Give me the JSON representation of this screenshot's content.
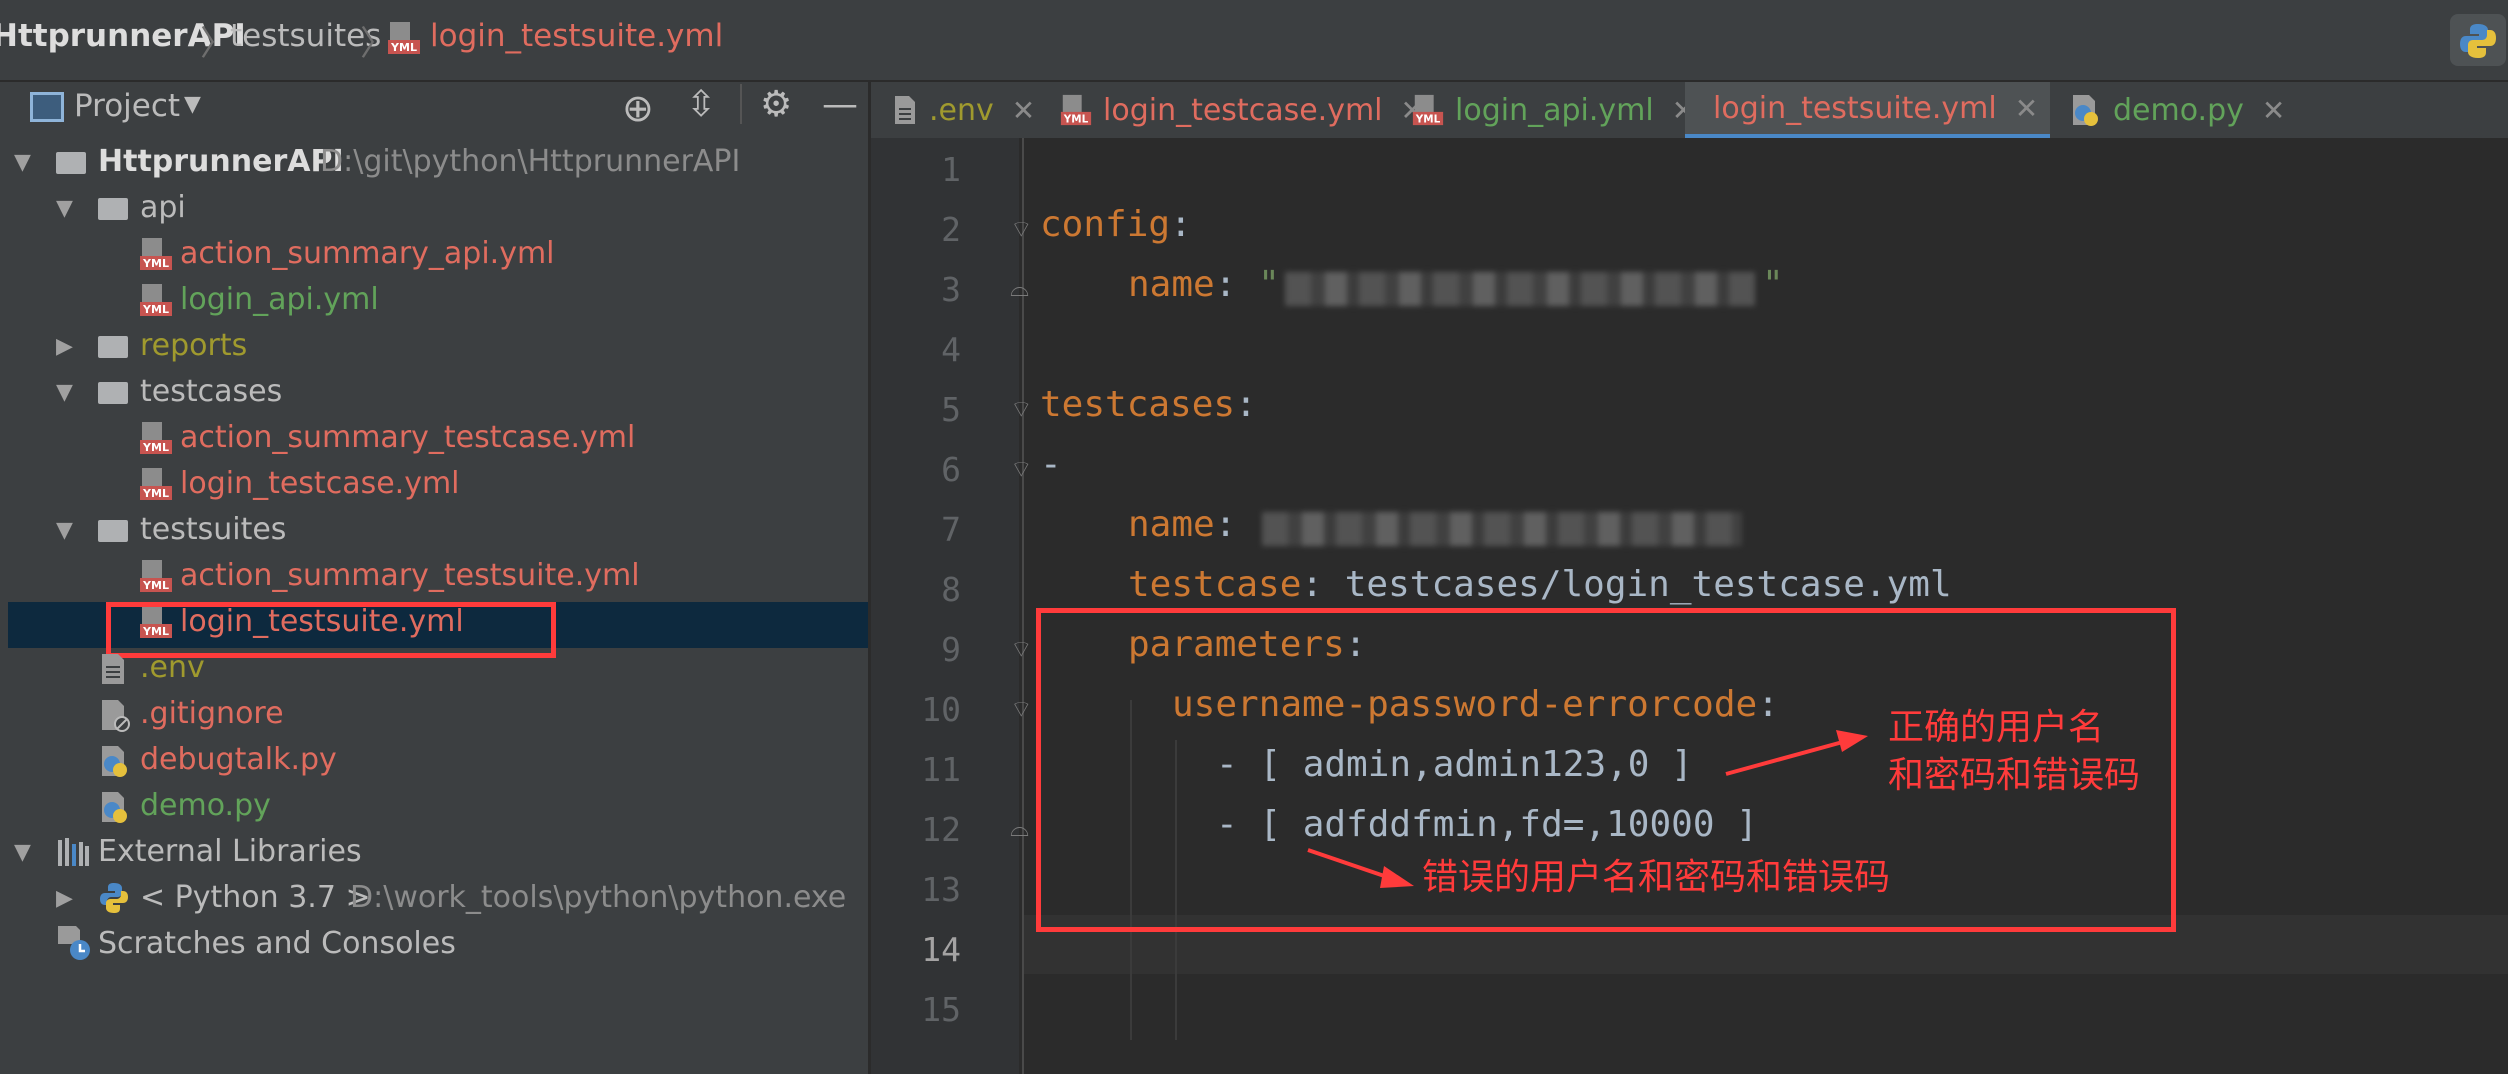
{
  "breadcrumb": {
    "project": "HttprunnerAPI",
    "folder": "testsuites",
    "file": "login_testsuite.yml"
  },
  "project_panel": {
    "title": "Project",
    "root": {
      "name": "HttprunnerAPI",
      "path": "D:\\git\\python\\HttprunnerAPI"
    },
    "api_folder": "api",
    "api_files": [
      "action_summary_api.yml",
      "login_api.yml"
    ],
    "reports_folder": "reports",
    "testcases_folder": "testcases",
    "testcase_files": [
      "action_summary_testcase.yml",
      "login_testcase.yml"
    ],
    "testsuites_folder": "testsuites",
    "testsuite_files": [
      "action_summary_testsuite.yml",
      "login_testsuite.yml"
    ],
    "root_files": [
      ".env",
      ".gitignore",
      "debugtalk.py",
      "demo.py"
    ],
    "external_libraries": "External Libraries",
    "python_sdk": {
      "name": "< Python 3.7 >",
      "path": "D:\\work_tools\\python\\python.exe"
    },
    "scratches": "Scratches and Consoles"
  },
  "tabs": [
    {
      "label": ".env",
      "icon": "text-file-icon",
      "active": false
    },
    {
      "label": "login_testcase.yml",
      "icon": "yml-file-icon",
      "active": false
    },
    {
      "label": "login_api.yml",
      "icon": "yml-file-icon",
      "active": false
    },
    {
      "label": "login_testsuite.yml",
      "icon": "yml-file-icon",
      "active": true
    },
    {
      "label": "demo.py",
      "icon": "python-file-icon",
      "active": false
    }
  ],
  "editor": {
    "line_numbers": [
      "1",
      "2",
      "3",
      "4",
      "5",
      "6",
      "7",
      "8",
      "9",
      "10",
      "11",
      "12",
      "13",
      "14",
      "15"
    ],
    "current_line": "14",
    "code": {
      "config_key": "config",
      "name_key": "name",
      "testcases_key": "testcases",
      "dash": "-",
      "testcase_key": "testcase",
      "testcase_value": "testcases/login_testcase.yml",
      "parameters_key": "parameters",
      "param_name": "username-password-errorcode",
      "row1": "- [ admin,admin123,0 ]",
      "row2": "- [ adfddfmin,fd=,10000 ]"
    }
  },
  "annotations": {
    "correct_line1": "正确的用户名",
    "correct_line2": "和密码和错误码",
    "wrong": "错误的用户名和密码和错误码"
  },
  "colors": {
    "keyword": "#cc7832",
    "annotation": "#ff3b3b",
    "selection": "#0d293e",
    "active_tab_underline": "#4a88c7"
  }
}
